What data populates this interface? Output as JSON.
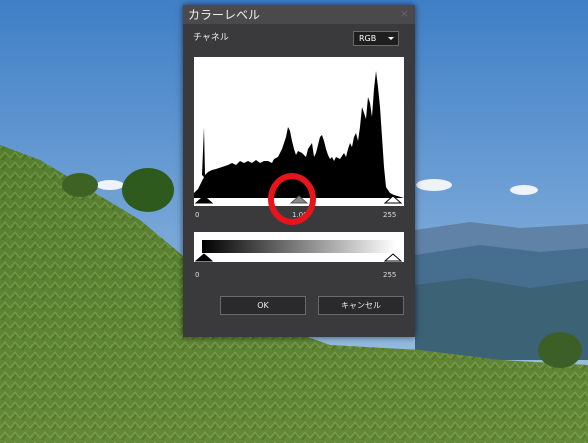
{
  "dialog": {
    "title": "カラーレベル",
    "close_glyph": "×",
    "channel_label": "チャネル",
    "channel_value": "RGB",
    "input_min": "0",
    "input_gamma": "1.00",
    "input_max": "255",
    "output_min": "0",
    "output_max": "255",
    "ok_label": "OK",
    "cancel_label": "キャンセル"
  },
  "colors": {
    "annotation": "#e8141b",
    "dialog_bg": "#3a3a3c"
  }
}
